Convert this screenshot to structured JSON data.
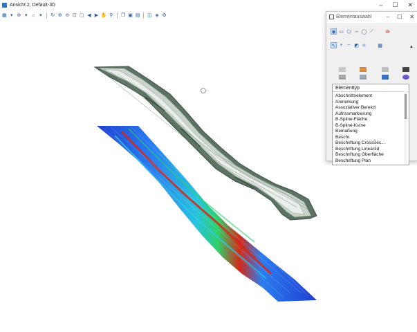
{
  "window": {
    "title": "Ansicht 2, Default-3D"
  },
  "window_controls": {
    "minimize": "–",
    "maximize": "☐",
    "close": "✕"
  },
  "toolbar": {
    "buttons": [
      "view-icon",
      "dropdown-icon",
      "view-group-icon",
      "dropdown-icon",
      "view-attributes-icon",
      "dropdown-icon",
      "rotate-icon",
      "zoom-in-icon",
      "zoom-out-icon",
      "fit-view-icon",
      "window-area-icon",
      "view-previous-icon",
      "view-next-icon",
      "pan-icon",
      "walk-icon",
      "copy-view-icon",
      "clip-volume-icon",
      "clip-mask-icon",
      "camera-icon",
      "display-style-icon",
      "view-settings-icon"
    ]
  },
  "panel": {
    "title": "Elementauswahl",
    "controls": {
      "minimize": "–",
      "maximize": "☐",
      "close": "✕"
    },
    "list_header": "Elementtyp",
    "items": [
      "Abschnittselement",
      "Anmerkung",
      "Assoziativer Bereich",
      "Aufrissmarkierung",
      "B-Spline-Fläche",
      "B-Spline-Kurve",
      "Bemaßung",
      "Beschr.",
      "Beschriftung CrossSec...",
      "Beschriftung Linear3d",
      "Beschriftung Oberfläche",
      "Beschriftung Plan"
    ]
  },
  "colors": {
    "accent": "#2b5ea7",
    "surface_dark": "#2f4a3a",
    "heat_low": "#1f3fd1",
    "heat_high": "#d42a1a"
  }
}
